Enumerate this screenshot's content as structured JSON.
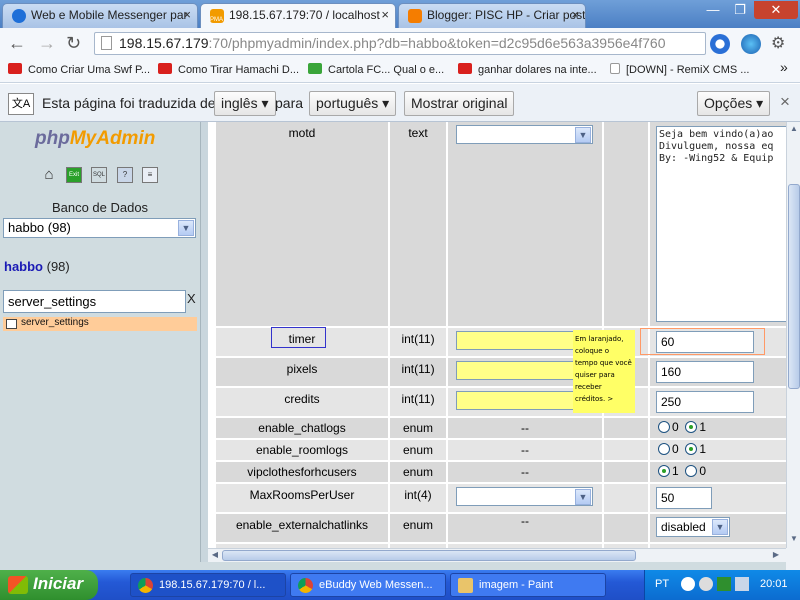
{
  "browser": {
    "tabs": [
      {
        "title": "Web e Mobile Messenger par",
        "close": "×"
      },
      {
        "title": "198.15.67.179:70 / localhost",
        "close": "×"
      },
      {
        "title": "Blogger: PISC HP - Criar post",
        "close": "×"
      }
    ],
    "tab_icon_label": "PMA",
    "window_controls": {
      "minimize": "—",
      "maximize": "❐",
      "close": "✕"
    },
    "address": {
      "host": "198.15.67.179",
      "path": ":70/phpmyadmin/index.php?db=habbo&token=d2c95d6e563a3956e4f760"
    },
    "bookmarks": [
      "Como Criar Uma Swf P...",
      "Como Tirar Hamachi D...",
      "Cartola FC... Qual o e...",
      "ganhar dolares na inte...",
      "[DOWN] - RemiX CMS ..."
    ],
    "bookmarks_more": "»"
  },
  "translate_bar": {
    "prefix": "Esta página foi traduzida de",
    "from_lang": "inglês",
    "to_label": "para",
    "to_lang": "português",
    "show_original": "Mostrar original",
    "options": "Opções",
    "close": "×"
  },
  "sidebar": {
    "logo_php": "php",
    "logo_admin": "MyAdmin",
    "nav_icons": [
      "home-icon",
      "exit-icon",
      "sql-icon",
      "help-icon",
      "docs-icon"
    ],
    "nav_icon_glyphs": [
      "⌂",
      "Exit",
      "SQL",
      "?",
      "≡"
    ],
    "db_label": "Banco de Dados",
    "db_select": "habbo (98)",
    "db_name": "habbo",
    "db_count": "(98)",
    "filter_value": "server_settings",
    "filter_clear": "X",
    "table_item": "server_settings"
  },
  "form": {
    "rows": [
      {
        "name": "motd",
        "type": "text",
        "fn": "select",
        "value": "Seja bem vindo(a)ao\nDivulguem, nossa eq\nBy: -Wing52 & Equip"
      },
      {
        "name": "timer",
        "type": "int(11)",
        "fn": "select-yellow",
        "value": "60"
      },
      {
        "name": "pixels",
        "type": "int(11)",
        "fn": "select-yellow",
        "value": "160"
      },
      {
        "name": "credits",
        "type": "int(11)",
        "fn": "select-yellow",
        "value": "250"
      },
      {
        "name": "enable_chatlogs",
        "type": "enum",
        "fn": "--",
        "radios": [
          {
            "label": "0",
            "on": false
          },
          {
            "label": "1",
            "on": true
          }
        ]
      },
      {
        "name": "enable_roomlogs",
        "type": "enum",
        "fn": "--",
        "radios": [
          {
            "label": "0",
            "on": false
          },
          {
            "label": "1",
            "on": true
          }
        ]
      },
      {
        "name": "vipclothesforhcusers",
        "type": "enum",
        "fn": "--",
        "radios": [
          {
            "label": "1",
            "on": true
          },
          {
            "label": "0",
            "on": false
          }
        ]
      },
      {
        "name": "MaxRoomsPerUser",
        "type": "int(4)",
        "fn": "select",
        "value": "50"
      },
      {
        "name": "enable_externalchatlinks",
        "type": "enum",
        "fn": "--",
        "select_value": "disabled"
      }
    ],
    "note": "Em laranjado, coloque o tempo que você quiser para receber créditos. >"
  },
  "taskbar": {
    "start": "Iniciar",
    "tasks": [
      "198.15.67.179:70 / l...",
      "eBuddy Web Messen...",
      "imagem - Paint"
    ],
    "lang": "PT",
    "clock": "20:01"
  },
  "colors": {
    "highlight_row": "#ffcc99",
    "fn_yellow": "#ffff88",
    "note_yellow": "#ffff66",
    "pma_orange": "#f29b00"
  }
}
